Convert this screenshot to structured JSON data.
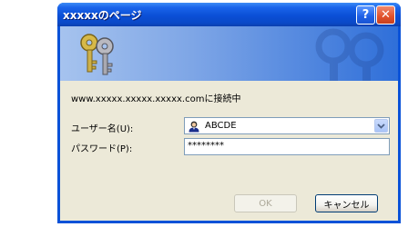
{
  "window": {
    "title": "xxxxxのページ",
    "help_symbol": "?",
    "close_symbol": "✕"
  },
  "dialog": {
    "connect_message": "www.xxxxx.xxxxx.xxxxx.comに接続中",
    "username_label": "ユーザー名(U):",
    "username_value": "ABCDE",
    "password_label": "パスワード(P):",
    "password_value": "********",
    "ok_label": "OK",
    "cancel_label": "キャンセル"
  },
  "icons": {
    "banner": "keys-icon",
    "user": "user-avatar-icon",
    "dropdown": "chevron-down-icon"
  },
  "colors": {
    "titlebar": "#0a52d8",
    "client": "#ece9d8",
    "close": "#e1512b"
  }
}
